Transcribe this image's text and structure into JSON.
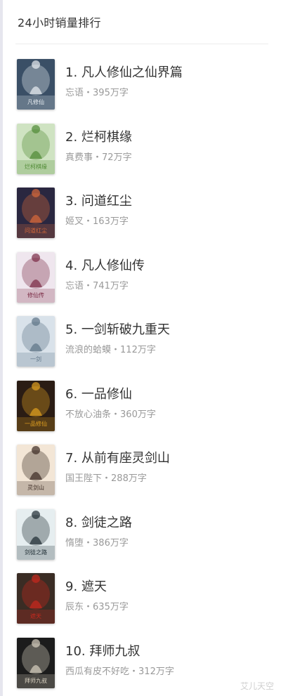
{
  "header": {
    "title": "24小时销量排行"
  },
  "books": [
    {
      "rank": "1.",
      "title": "凡人修仙之仙界篇",
      "author": "忘语",
      "words": "395万字",
      "cover_text": "凡修仙",
      "cover_bg": "#3a4f66",
      "cover_accent": "#e9eef2"
    },
    {
      "rank": "2.",
      "title": "烂柯棋缘",
      "author": "真费事",
      "words": "72万字",
      "cover_text": "烂柯棋缘",
      "cover_bg": "#cfe3c2",
      "cover_accent": "#4f8a34"
    },
    {
      "rank": "3.",
      "title": "问道红尘",
      "author": "姬叉",
      "words": "163万字",
      "cover_text": "问道红尘",
      "cover_bg": "#2a2740",
      "cover_accent": "#d86a3a"
    },
    {
      "rank": "4.",
      "title": "凡人修仙传",
      "author": "忘语",
      "words": "741万字",
      "cover_text": "修仙传",
      "cover_bg": "#efe6ee",
      "cover_accent": "#7a2a44"
    },
    {
      "rank": "5.",
      "title": "一剑斩破九重天",
      "author": "流浪的蛤蟆",
      "words": "112万字",
      "cover_text": "一剑",
      "cover_bg": "#d9e2ea",
      "cover_accent": "#5d7386"
    },
    {
      "rank": "6.",
      "title": "一品修仙",
      "author": "不放心油条",
      "words": "360万字",
      "cover_text": "一品修仙",
      "cover_bg": "#2a1c14",
      "cover_accent": "#e0a020"
    },
    {
      "rank": "7.",
      "title": "从前有座灵剑山",
      "author": "国王陛下",
      "words": "288万字",
      "cover_text": "灵剑山",
      "cover_bg": "#f3e6d6",
      "cover_accent": "#3a2a22"
    },
    {
      "rank": "8.",
      "title": "剑徒之路",
      "author": "惰堕",
      "words": "386万字",
      "cover_text": "剑徒之路",
      "cover_bg": "#e6eef0",
      "cover_accent": "#1c2a30"
    },
    {
      "rank": "9.",
      "title": "遮天",
      "author": "辰东",
      "words": "635万字",
      "cover_text": "遮天",
      "cover_bg": "#3a2c24",
      "cover_accent": "#c8281e"
    },
    {
      "rank": "10.",
      "title": "拜师九叔",
      "author": "西瓜有皮不好吃",
      "words": "312万字",
      "cover_text": "拜师九叔",
      "cover_bg": "#1c1c1c",
      "cover_accent": "#d8d0c0"
    }
  ],
  "separator": "・",
  "watermark": "艾儿天空"
}
